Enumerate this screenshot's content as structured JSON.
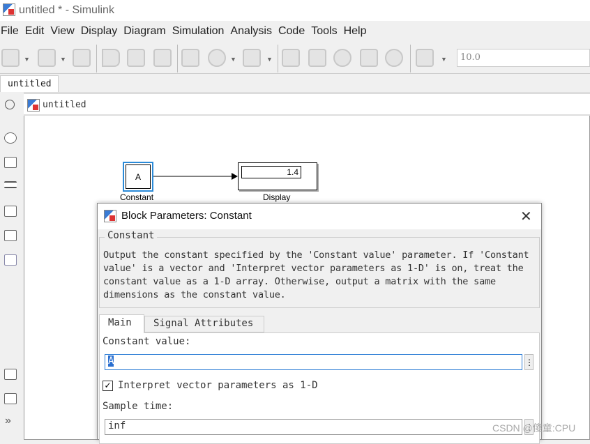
{
  "window": {
    "title": "untitled * - Simulink"
  },
  "menu": [
    "File",
    "Edit",
    "View",
    "Display",
    "Diagram",
    "Simulation",
    "Analysis",
    "Code",
    "Tools",
    "Help"
  ],
  "toolbar": {
    "icons": [
      "new-model-icon",
      "open-icon",
      "save-icon",
      "back-icon",
      "forward-icon",
      "up-icon",
      "library-browser-icon",
      "model-settings-icon",
      "model-explorer-icon",
      "update-diagram-icon",
      "step-back-icon",
      "run-icon",
      "step-forward-icon",
      "stop-icon",
      "scope-icon"
    ],
    "stop_time": "10.0"
  },
  "tab": {
    "label": "untitled"
  },
  "address": {
    "path": "untitled"
  },
  "blocks": {
    "constant": {
      "text": "A",
      "label": "Constant"
    },
    "display": {
      "value": "1.4",
      "label": "Display"
    }
  },
  "dialog": {
    "title": "Block Parameters: Constant",
    "group": "Constant",
    "description": "Output the constant specified by the 'Constant value' parameter. If 'Constant value' is a vector and 'Interpret vector parameters as 1-D' is on, treat the constant value as a 1-D array. Otherwise, output a matrix with the same dimensions as the constant value.",
    "tabs": [
      "Main",
      "Signal Attributes"
    ],
    "constant_value_label": "Constant value:",
    "constant_value": "A",
    "interpret_label": "Interpret vector parameters as 1-D",
    "interpret_checked": true,
    "sample_time_label": "Sample time:",
    "sample_time": "inf"
  },
  "watermark": "CSDN @傻童:CPU"
}
